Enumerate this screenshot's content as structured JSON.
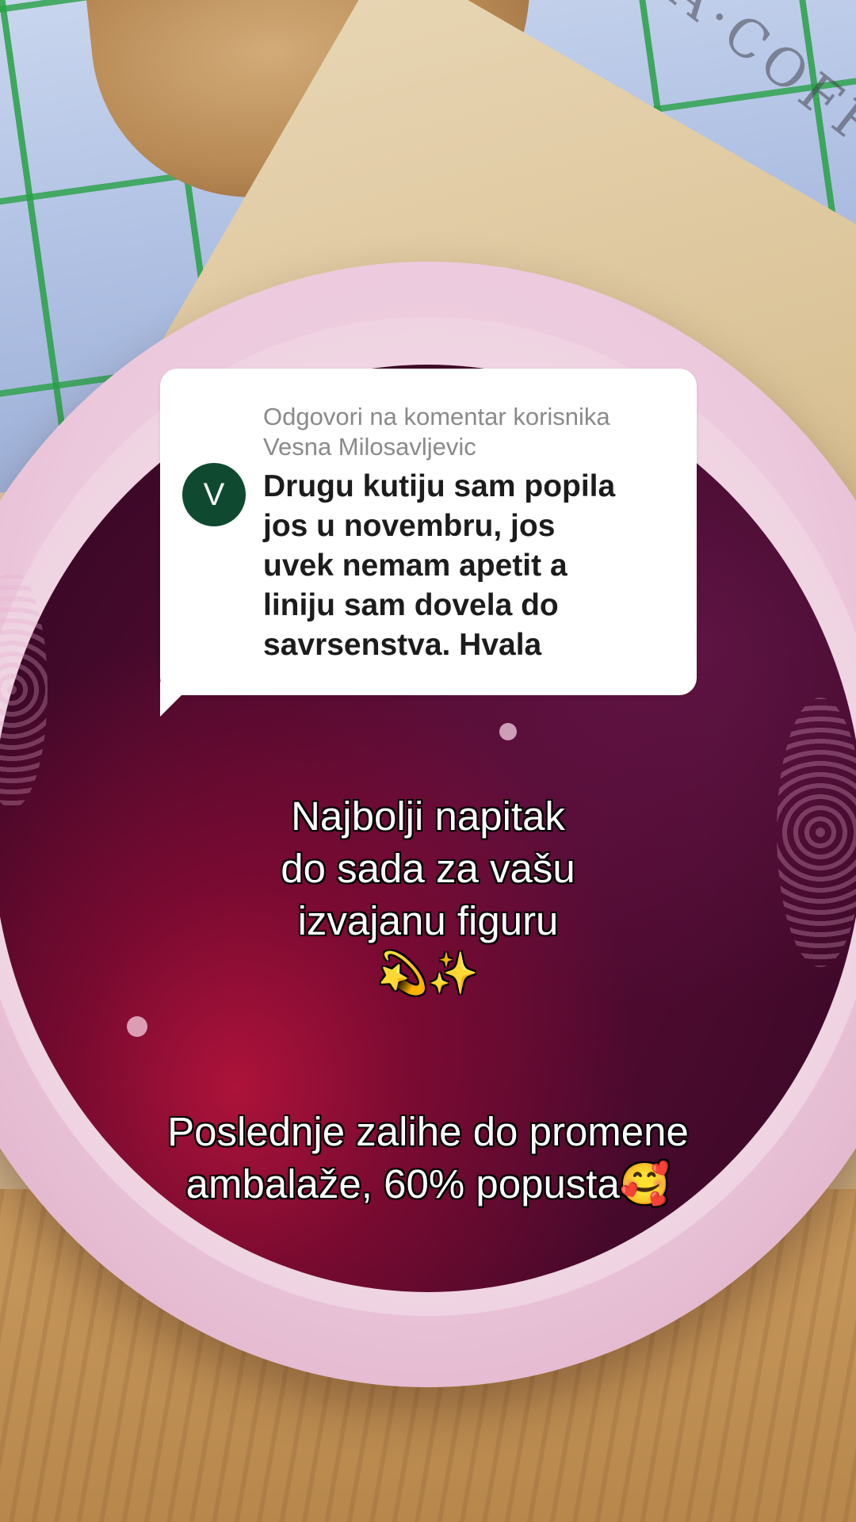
{
  "background": {
    "cloth_print": "LA·COFFE"
  },
  "reply_card": {
    "header_line1": "Odgovori na komentar korisnika",
    "header_line2": "Vesna Milosavljevic",
    "avatar_letter": "V",
    "avatar_color": "#0f4a30",
    "comment_lines": [
      "Drugu kutiju sam popila",
      "jos u novembru, jos",
      "uvek nemam apetit a",
      "liniju sam dovela do",
      "savrsenstva. Hvala"
    ]
  },
  "caption_main": {
    "lines": [
      "Najbolji napitak",
      "do sada za vašu",
      "izvajanu figuru",
      "💫✨"
    ]
  },
  "caption_promo": {
    "lines": [
      "Poslednje zalihe do promene",
      "ambalaže, 60% popusta🥰"
    ]
  }
}
